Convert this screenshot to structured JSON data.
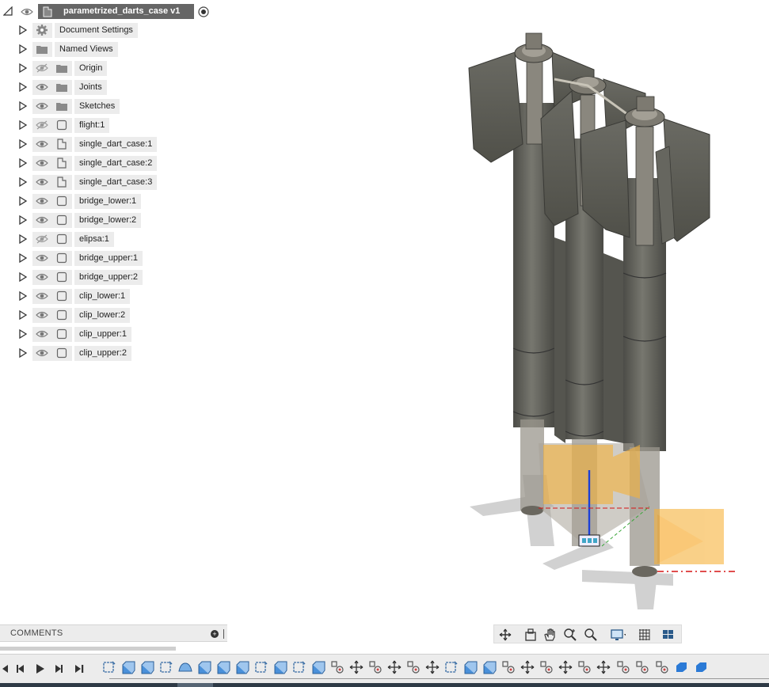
{
  "browser": {
    "root": {
      "label": "parametrized_darts_case v1"
    },
    "items": [
      {
        "label": "Document Settings",
        "icon": "gear-icon",
        "eye": "none"
      },
      {
        "label": "Named Views",
        "icon": "folder-icon",
        "eye": "none"
      },
      {
        "label": "Origin",
        "icon": "folder-icon",
        "eye": "hidden"
      },
      {
        "label": "Joints",
        "icon": "folder-icon",
        "eye": "visible"
      },
      {
        "label": "Sketches",
        "icon": "folder-icon",
        "eye": "visible"
      },
      {
        "label": "flight:1",
        "icon": "body-icon",
        "eye": "hidden"
      },
      {
        "label": "single_dart_case:1",
        "icon": "component-icon",
        "eye": "visible"
      },
      {
        "label": "single_dart_case:2",
        "icon": "component-icon",
        "eye": "visible"
      },
      {
        "label": "single_dart_case:3",
        "icon": "component-icon",
        "eye": "visible"
      },
      {
        "label": "bridge_lower:1",
        "icon": "body-icon",
        "eye": "visible"
      },
      {
        "label": "bridge_lower:2",
        "icon": "body-icon",
        "eye": "visible"
      },
      {
        "label": "elipsa:1",
        "icon": "body-icon",
        "eye": "hidden"
      },
      {
        "label": "bridge_upper:1",
        "icon": "body-icon",
        "eye": "visible"
      },
      {
        "label": "bridge_upper:2",
        "icon": "body-icon",
        "eye": "visible"
      },
      {
        "label": "clip_lower:1",
        "icon": "body-icon",
        "eye": "visible"
      },
      {
        "label": "clip_lower:2",
        "icon": "body-icon",
        "eye": "visible"
      },
      {
        "label": "clip_upper:1",
        "icon": "body-icon",
        "eye": "visible"
      },
      {
        "label": "clip_upper:2",
        "icon": "body-icon",
        "eye": "visible"
      }
    ]
  },
  "comments": {
    "label": "COMMENTS",
    "add": "+"
  },
  "navbar": {
    "buttons": [
      "orbit-icon",
      "look-at-icon",
      "pan-icon",
      "zoom-icon",
      "fit-icon",
      "display-settings-icon",
      "grid-settings-icon",
      "viewports-icon"
    ]
  },
  "timeline": {
    "playback": [
      "go-to-start-icon",
      "step-back-icon",
      "play-icon",
      "step-forward-icon",
      "go-to-end-icon"
    ],
    "feature_count": 32
  },
  "colors": {
    "model": "#5e5e58",
    "model_light": "#7a7a73",
    "model_dark": "#44443f",
    "selection": "#f6b23a",
    "axis_blue": "#1a3fd8",
    "axis_red": "#d61414",
    "axis_green": "#3aa63a"
  }
}
